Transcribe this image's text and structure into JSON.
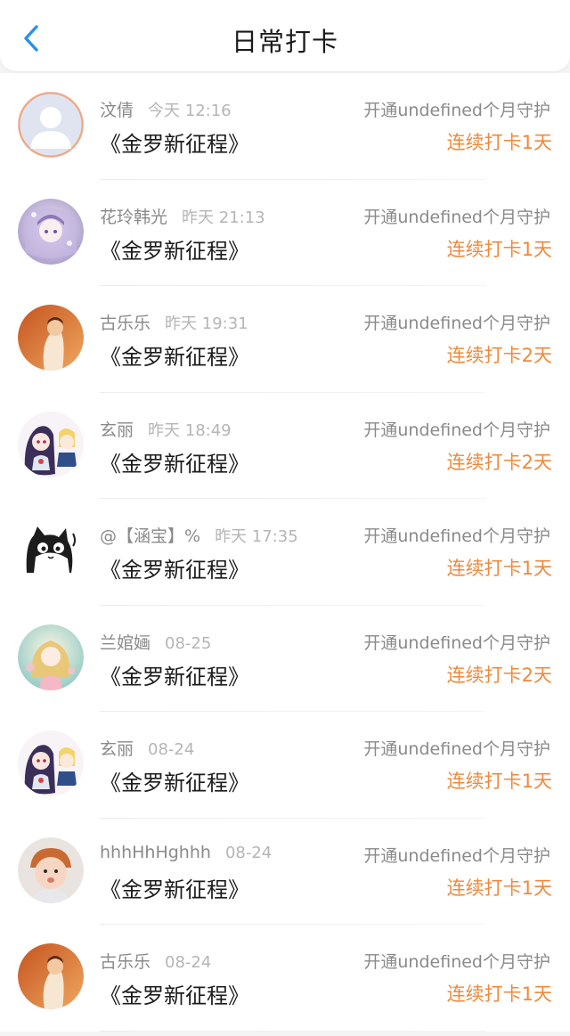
{
  "header": {
    "title": "日常打卡",
    "back_icon": "chevron-left-icon",
    "accent_color": "#2b8ff0"
  },
  "colors": {
    "streak": "#f0893c",
    "secondary_text": "#8a8a8a",
    "time_text": "#b5b5b5"
  },
  "entries": [
    {
      "name": "汶倩",
      "time": "今天 12:16",
      "book": "《金罗新征程》",
      "guard": "开通undefined个月守护",
      "streak": "连续打卡1天",
      "avatar": "default-avatar"
    },
    {
      "name": "花玲韩光",
      "time": "昨天 21:13",
      "book": "《金罗新征程》",
      "guard": "开通undefined个月守护",
      "streak": "连续打卡1天",
      "avatar": "anime-girl-purple"
    },
    {
      "name": "古乐乐",
      "time": "昨天 19:31",
      "book": "《金罗新征程》",
      "guard": "开通undefined个月守护",
      "streak": "连续打卡2天",
      "avatar": "photo-orange"
    },
    {
      "name": "玄丽",
      "time": "昨天 18:49",
      "book": "《金罗新征程》",
      "guard": "开通undefined个月守护",
      "streak": "连续打卡2天",
      "avatar": "anime-pair"
    },
    {
      "name": "@【涵宝】%",
      "time": "昨天 17:35",
      "book": "《金罗新征程》",
      "guard": "开通undefined个月守护",
      "streak": "连续打卡1天",
      "avatar": "cartoon-cat"
    },
    {
      "name": "兰婠婳",
      "time": "08-25",
      "book": "《金罗新征程》",
      "guard": "开通undefined个月守护",
      "streak": "连续打卡2天",
      "avatar": "anime-girl-pastel"
    },
    {
      "name": "玄丽",
      "time": "08-24",
      "book": "《金罗新征程》",
      "guard": "开通undefined个月守护",
      "streak": "连续打卡1天",
      "avatar": "anime-pair"
    },
    {
      "name": "hhhHhHghhh",
      "time": "08-24",
      "book": "《金罗新征程》",
      "guard": "开通undefined个月守护",
      "streak": "连续打卡1天",
      "avatar": "baby-photo"
    },
    {
      "name": "古乐乐",
      "time": "08-24",
      "book": "《金罗新征程》",
      "guard": "开通undefined个月守护",
      "streak": "连续打卡1天",
      "avatar": "photo-orange"
    }
  ]
}
